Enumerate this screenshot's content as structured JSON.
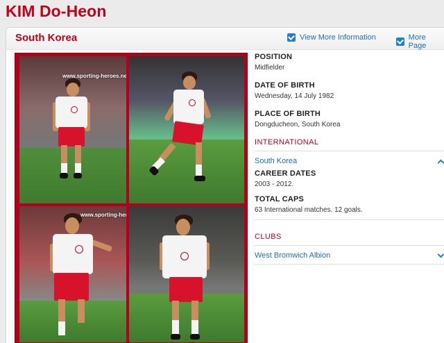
{
  "header": {
    "title": "KIM Do-Heon"
  },
  "card": {
    "country": "South Korea",
    "links": [
      {
        "label": "View More Information",
        "icon": "checkbox-icon"
      },
      {
        "label": "More Page",
        "icon": "checkbox-icon"
      }
    ]
  },
  "photos": {
    "watermark": "www.sporting-heroes.net",
    "frame_color": "#b4001a"
  },
  "details": {
    "position": {
      "label": "POSITION",
      "value": "Midfielder"
    },
    "dob": {
      "label": "DATE OF BIRTH",
      "value": "Wednesday, 14 July 1982"
    },
    "pob": {
      "label": "PLACE OF BIRTH",
      "value": "Dongducheon, South Korea"
    }
  },
  "international": {
    "heading": "INTERNATIONAL",
    "team": "South Korea",
    "career_dates": {
      "label": "CAREER DATES",
      "value": "2003 - 2012."
    },
    "total_caps": {
      "label": "TOTAL CAPS",
      "value": "63 International matches. 12 goals."
    }
  },
  "clubs": {
    "heading": "CLUBS",
    "items": [
      "West Bromwich Albion"
    ]
  },
  "colors": {
    "accent": "#c4001a",
    "link": "#1f6fb5"
  }
}
